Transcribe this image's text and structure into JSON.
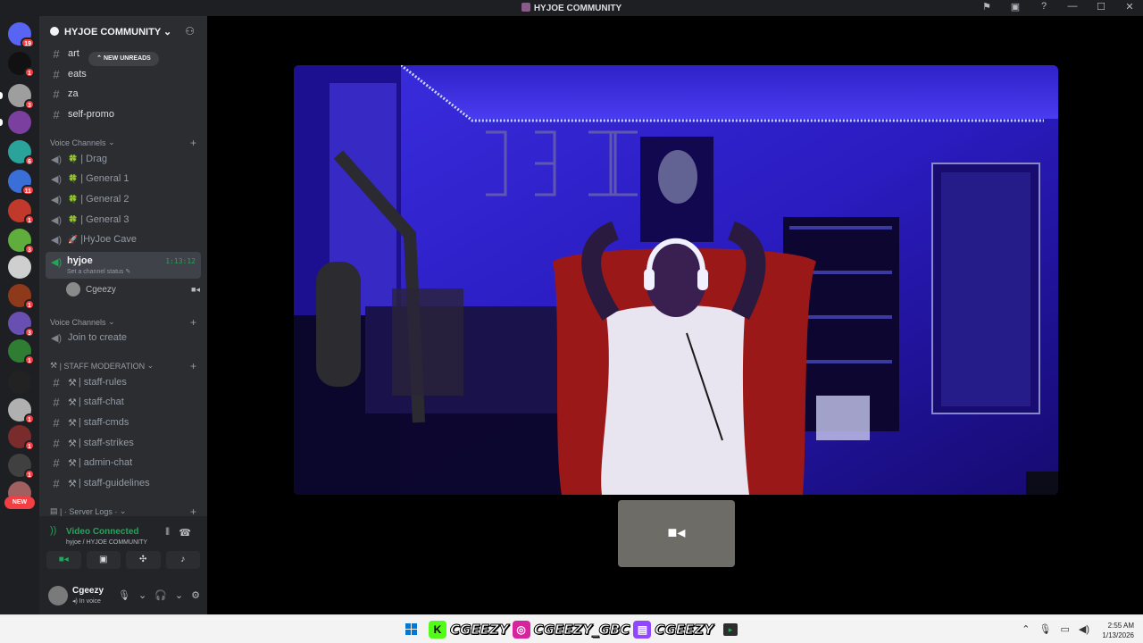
{
  "window": {
    "title": "HYJOE COMMUNITY",
    "icons": [
      "flag-icon",
      "inbox-icon",
      "help-icon",
      "minimize-icon",
      "maximize-icon",
      "close-icon"
    ]
  },
  "servers": {
    "items": [
      {
        "name": "discord-home",
        "color": "#5865f2",
        "badge": "19"
      },
      {
        "name": "server-1",
        "color": "#111111",
        "badge": "1"
      },
      {
        "name": "server-2",
        "color": "#9e9e9e",
        "badge": "3"
      },
      {
        "name": "server-3",
        "color": "#7b3fa0",
        "badge": ""
      },
      {
        "name": "server-4",
        "color": "#2aa39b",
        "badge": "6"
      },
      {
        "name": "server-5",
        "color": "#3a6fd8",
        "badge": "11"
      },
      {
        "name": "server-6",
        "color": "#c0392b",
        "badge": "1"
      },
      {
        "name": "server-7",
        "color": "#5fae3d",
        "badge": "3"
      },
      {
        "name": "server-8",
        "color": "#cfcfcf",
        "badge": ""
      },
      {
        "name": "server-9",
        "color": "#8e3a1a",
        "badge": "1"
      },
      {
        "name": "server-10",
        "color": "#6a4fb3",
        "badge": "3"
      },
      {
        "name": "server-11",
        "color": "#2e7d32",
        "badge": "1"
      },
      {
        "name": "server-12",
        "color": "#222222",
        "badge": ""
      },
      {
        "name": "server-13",
        "color": "#b0b0b0",
        "badge": "1"
      },
      {
        "name": "server-14",
        "color": "#7a2c2c",
        "badge": "1"
      },
      {
        "name": "server-15",
        "color": "#404040",
        "badge": "1"
      },
      {
        "name": "server-16",
        "color": "#a06060",
        "badge": ""
      }
    ],
    "new_label": "NEW"
  },
  "guild": {
    "name": "HYJOE COMMUNITY",
    "new_unreads": "NEW UNREADS"
  },
  "text_channels": [
    {
      "name": "art"
    },
    {
      "name": "eats"
    },
    {
      "name": "za"
    },
    {
      "name": "self-promo"
    }
  ],
  "voice_category_1": "Voice Channels",
  "voice_channels": [
    {
      "name": "| Drag",
      "emoji": "🍀"
    },
    {
      "name": "| General 1",
      "emoji": "🍀"
    },
    {
      "name": "| General 2",
      "emoji": "🍀"
    },
    {
      "name": "| General 3",
      "emoji": "🍀"
    },
    {
      "name": "|HyJoe Cave",
      "emoji": "🚀"
    }
  ],
  "active_voice": {
    "name": "hyjoe",
    "time": "1:13:12",
    "status": "Set a channel status ✎",
    "user": "Cgeezy"
  },
  "voice_category_2": "Voice Channels",
  "join_to_create": "Join to create",
  "staff_category": "| STAFF MODERATION",
  "staff_channels": [
    {
      "name": "| staff-rules"
    },
    {
      "name": "|  staff-chat"
    },
    {
      "name": "| staff-cmds"
    },
    {
      "name": "| staff-strikes"
    },
    {
      "name": "| admin-chat"
    },
    {
      "name": "| staff-guidelines"
    }
  ],
  "server_logs_category": "| · Server Logs ·",
  "voice_panel": {
    "status": "Video Connected",
    "subtitle": "hyjoe / HYJOE COMMUNITY"
  },
  "user": {
    "name": "Cgeezy",
    "status": "In voice"
  },
  "taskbar": {
    "banner": [
      "CGEEZY",
      "CGEEZY_GBC",
      "CGEEZY"
    ],
    "time": "2:55 AM",
    "date": "1/13/2026"
  },
  "colors": {
    "accent_green": "#23a55a",
    "badge_red": "#f23f43",
    "video_blue": "#2313a8"
  }
}
